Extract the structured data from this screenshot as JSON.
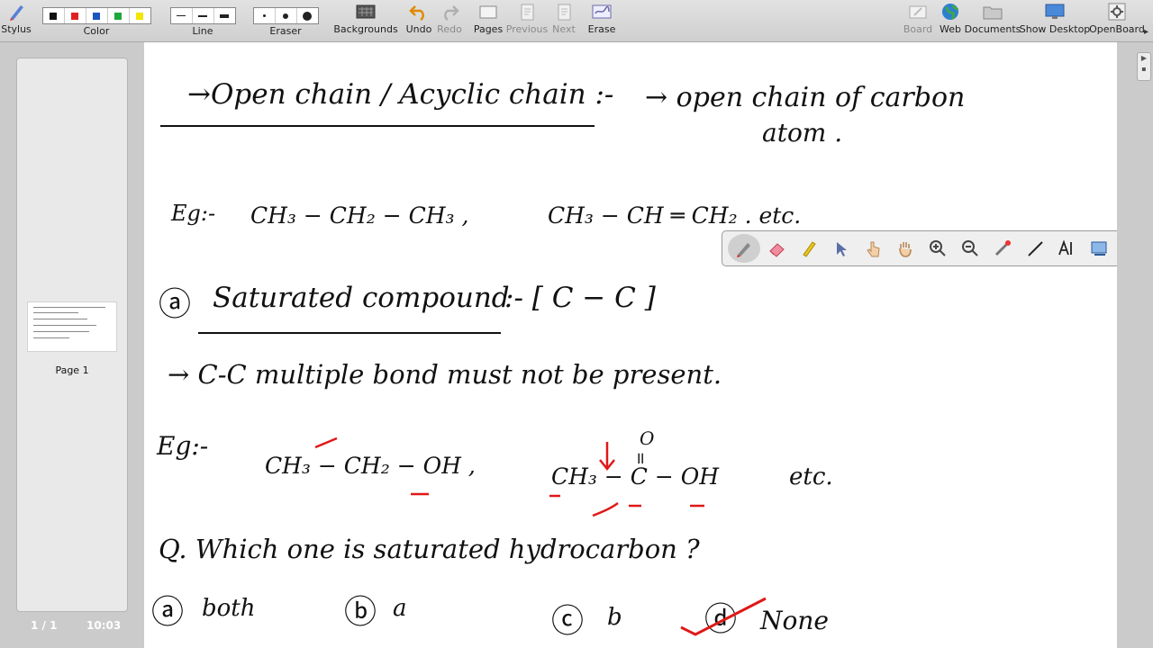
{
  "toolbar": {
    "stylus": "Stylus",
    "color": "Color",
    "line": "Line",
    "eraser": "Eraser",
    "backgrounds": "Backgrounds",
    "undo": "Undo",
    "redo": "Redo",
    "pages": "Pages",
    "previous": "Previous",
    "next": "Next",
    "erase": "Erase",
    "board": "Board",
    "web": "Web",
    "documents": "Documents",
    "show_desktop": "Show Desktop",
    "openboard": "OpenBoard",
    "colors": [
      "#111111",
      "#e02020",
      "#1a55c0",
      "#1fa83a",
      "#f2e600"
    ]
  },
  "sidebar": {
    "page_label": "Page 1",
    "page_count": "1 / 1",
    "clock": "10:03"
  },
  "board": {
    "line1_heading": "→Open chain / Acyclic chain :-",
    "line1_def_a": "→ open chain of carbon",
    "line1_def_b": "atom .",
    "line2_eg": "Eg:-",
    "line2_f1": "CH₃ − CH₂ − CH₃ ,",
    "line2_f2": "CH₃ − CH ═ CH₂ . etc.",
    "line3_num": "ⓐ",
    "line3_heading": "Saturated compound",
    "line3_rule": ":- [ C − C ]",
    "line4": "→ C-C multiple bond must not be present.",
    "line5_eg": "Eg:-",
    "line5_f1": "CH₃ − CH₂ − OH ,",
    "line5_f2": "CH₃ − C − OH",
    "line5_o": "O",
    "line5_dbl": "॥",
    "line5_etc": "etc.",
    "question": "Q. Which one is saturated hydrocarbon ?",
    "opt_a_mark": "ⓐ",
    "opt_a": "both",
    "opt_b_mark": "ⓑ",
    "opt_b": "a",
    "opt_c_mark": "ⓒ",
    "opt_c": "b",
    "opt_d_mark": "ⓓ",
    "opt_d": "None",
    "ink_color": "#e01818"
  }
}
